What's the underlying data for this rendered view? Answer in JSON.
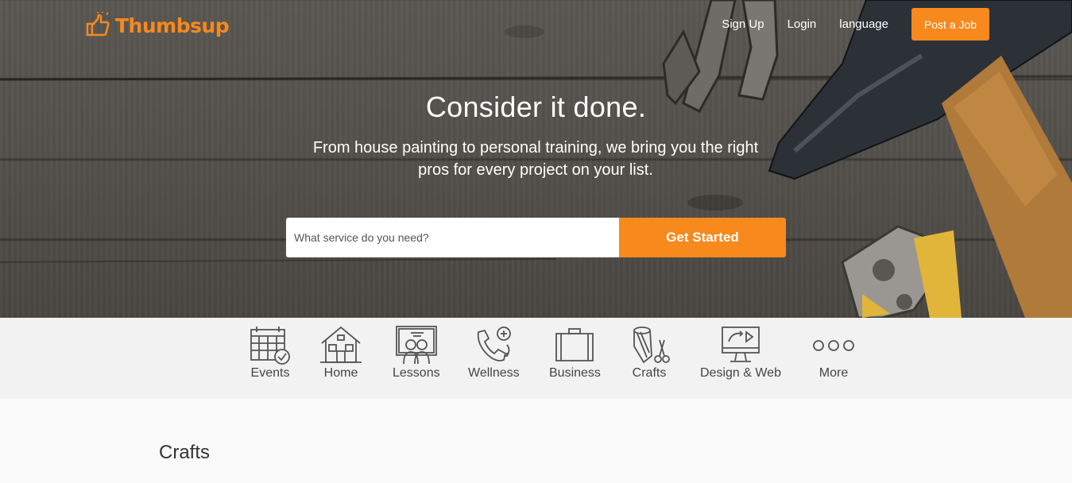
{
  "brand": {
    "name": "Thumbsup",
    "color": "#f7891d"
  },
  "nav": {
    "signup": "Sign Up",
    "login": "Login",
    "language": "language",
    "post_job": "Post a Job"
  },
  "hero": {
    "headline": "Consider it done.",
    "subline": "From house painting to personal training, we bring you the right pros for every project on your list.",
    "search_placeholder": "What service do you need?",
    "cta": "Get Started"
  },
  "categories": [
    {
      "label": "Events",
      "icon": "calendar-check-icon"
    },
    {
      "label": "Home",
      "icon": "house-icon"
    },
    {
      "label": "Lessons",
      "icon": "classroom-icon"
    },
    {
      "label": "Wellness",
      "icon": "phone-health-icon"
    },
    {
      "label": "Business",
      "icon": "briefcase-icon"
    },
    {
      "label": "Crafts",
      "icon": "yarn-scissors-icon"
    },
    {
      "label": "Design & Web",
      "icon": "monitor-design-icon"
    },
    {
      "label": "More",
      "icon": "more-dots-icon"
    }
  ],
  "section": {
    "title": "Crafts"
  }
}
